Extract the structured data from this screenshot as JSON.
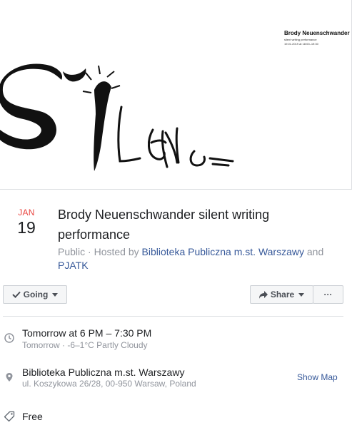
{
  "poster": {
    "artist": "Brody Neuenschwander",
    "subtitle": "silent writing performance",
    "datetime": "19.01.2019 at 18:00–19:30"
  },
  "event": {
    "month": "JAN",
    "day": "19",
    "title": "Brody Neuenschwander silent writing performance",
    "privacy": "Public",
    "hosted_by_prefix": "Hosted by",
    "host1": "Biblioteka Publiczna m.st. Warszawy",
    "and_word": "and",
    "host2": "PJATK"
  },
  "actions": {
    "going_label": "Going",
    "share_label": "Share",
    "more_label": "···"
  },
  "details": {
    "time_main": "Tomorrow at 6 PM – 7:30 PM",
    "time_sub": "Tomorrow · -6–1°C Partly Cloudy",
    "place_main": "Biblioteka Publiczna m.st. Warszawy",
    "place_sub": "ul. Koszykowa 26/28, 00-950 Warsaw, Poland",
    "show_map": "Show Map",
    "price": "Free"
  },
  "icons": {
    "going": "check-icon",
    "share": "share-arrow-icon",
    "time": "clock-icon",
    "place": "map-pin-icon",
    "price": "ticket-tag-icon"
  },
  "colors": {
    "month": "#e9453f",
    "link": "#365899",
    "muted": "#90949c"
  }
}
